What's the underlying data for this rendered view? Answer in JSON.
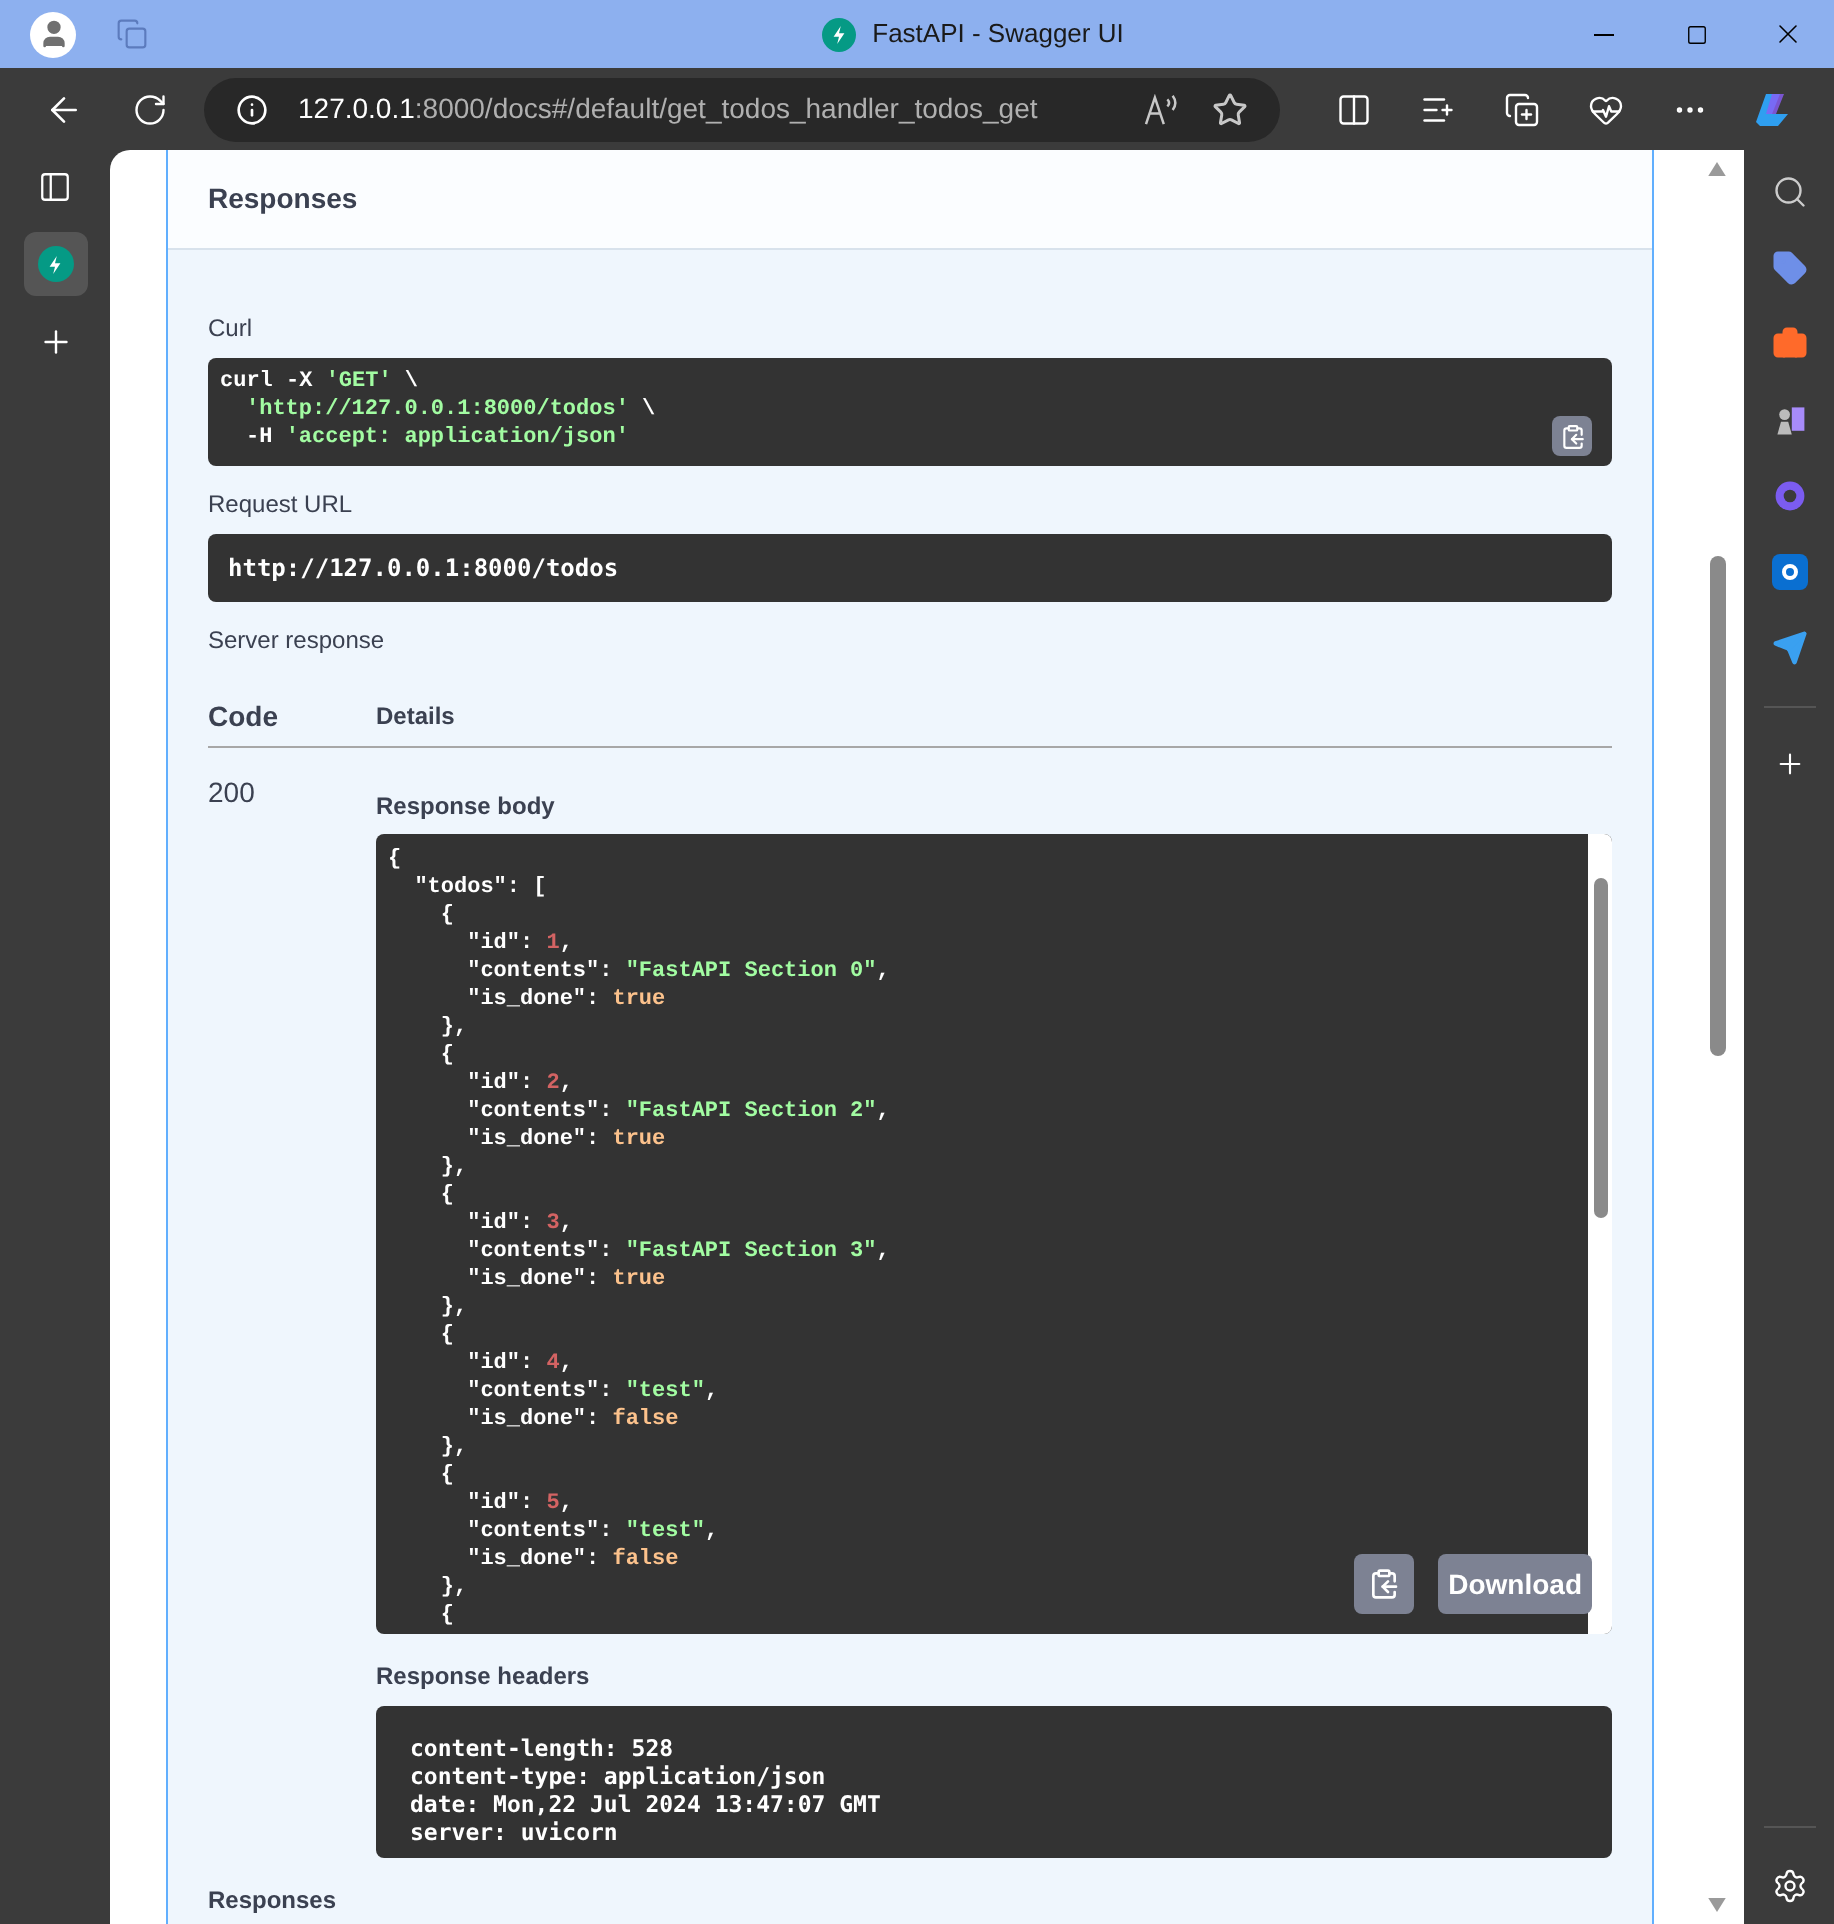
{
  "window": {
    "title": "FastAPI - Swagger UI"
  },
  "address_bar": {
    "host": "127.0.0.1",
    "path": ":8000/docs#/default/get_todos_handler_todos_get"
  },
  "section_header": "Responses",
  "curl": {
    "label": "Curl",
    "lines": [
      [
        {
          "kind": "plain",
          "text": "curl -X "
        },
        {
          "kind": "string",
          "text": "'GET'"
        },
        {
          "kind": "plain",
          "text": " \\"
        }
      ],
      [
        {
          "kind": "string",
          "text": "'http://127.0.0.1:8000/todos'"
        },
        {
          "kind": "plain",
          "text": " \\"
        }
      ],
      [
        {
          "kind": "plain",
          "text": "-H "
        },
        {
          "kind": "string",
          "text": "'accept: application/json'"
        }
      ]
    ]
  },
  "request_url": {
    "label": "Request URL",
    "value": "http://127.0.0.1:8000/todos"
  },
  "server_response": {
    "label": "Server response",
    "columns": [
      "Code",
      "Details"
    ],
    "code": "200",
    "body_label": "Response body",
    "download_label": "Download",
    "headers_label": "Response headers",
    "body_lines": [
      [
        {
          "kind": "plain",
          "text": "{"
        }
      ],
      [
        {
          "kind": "plain",
          "text": "  \"todos\": ["
        }
      ],
      [
        {
          "kind": "plain",
          "text": "    {"
        }
      ],
      [
        {
          "kind": "plain",
          "text": "      \"id\": "
        },
        {
          "kind": "number",
          "text": "1"
        },
        {
          "kind": "plain",
          "text": ","
        }
      ],
      [
        {
          "kind": "plain",
          "text": "      \"contents\": "
        },
        {
          "kind": "string",
          "text": "\"FastAPI Section 0\""
        },
        {
          "kind": "plain",
          "text": ","
        }
      ],
      [
        {
          "kind": "plain",
          "text": "      \"is_done\": "
        },
        {
          "kind": "bool",
          "text": "true"
        }
      ],
      [
        {
          "kind": "plain",
          "text": "    },"
        }
      ],
      [
        {
          "kind": "plain",
          "text": "    {"
        }
      ],
      [
        {
          "kind": "plain",
          "text": "      \"id\": "
        },
        {
          "kind": "number",
          "text": "2"
        },
        {
          "kind": "plain",
          "text": ","
        }
      ],
      [
        {
          "kind": "plain",
          "text": "      \"contents\": "
        },
        {
          "kind": "string",
          "text": "\"FastAPI Section 2\""
        },
        {
          "kind": "plain",
          "text": ","
        }
      ],
      [
        {
          "kind": "plain",
          "text": "      \"is_done\": "
        },
        {
          "kind": "bool",
          "text": "true"
        }
      ],
      [
        {
          "kind": "plain",
          "text": "    },"
        }
      ],
      [
        {
          "kind": "plain",
          "text": "    {"
        }
      ],
      [
        {
          "kind": "plain",
          "text": "      \"id\": "
        },
        {
          "kind": "number",
          "text": "3"
        },
        {
          "kind": "plain",
          "text": ","
        }
      ],
      [
        {
          "kind": "plain",
          "text": "      \"contents\": "
        },
        {
          "kind": "string",
          "text": "\"FastAPI Section 3\""
        },
        {
          "kind": "plain",
          "text": ","
        }
      ],
      [
        {
          "kind": "plain",
          "text": "      \"is_done\": "
        },
        {
          "kind": "bool",
          "text": "true"
        }
      ],
      [
        {
          "kind": "plain",
          "text": "    },"
        }
      ],
      [
        {
          "kind": "plain",
          "text": "    {"
        }
      ],
      [
        {
          "kind": "plain",
          "text": "      \"id\": "
        },
        {
          "kind": "number",
          "text": "4"
        },
        {
          "kind": "plain",
          "text": ","
        }
      ],
      [
        {
          "kind": "plain",
          "text": "      \"contents\": "
        },
        {
          "kind": "string",
          "text": "\"test\""
        },
        {
          "kind": "plain",
          "text": ","
        }
      ],
      [
        {
          "kind": "plain",
          "text": "      \"is_done\": "
        },
        {
          "kind": "bool",
          "text": "false"
        }
      ],
      [
        {
          "kind": "plain",
          "text": "    },"
        }
      ],
      [
        {
          "kind": "plain",
          "text": "    {"
        }
      ],
      [
        {
          "kind": "plain",
          "text": "      \"id\": "
        },
        {
          "kind": "number",
          "text": "5"
        },
        {
          "kind": "plain",
          "text": ","
        }
      ],
      [
        {
          "kind": "plain",
          "text": "      \"contents\": "
        },
        {
          "kind": "string",
          "text": "\"test\""
        },
        {
          "kind": "plain",
          "text": ","
        }
      ],
      [
        {
          "kind": "plain",
          "text": "      \"is_done\": "
        },
        {
          "kind": "bool",
          "text": "false"
        }
      ],
      [
        {
          "kind": "plain",
          "text": "    },"
        }
      ],
      [
        {
          "kind": "plain",
          "text": "    {"
        }
      ]
    ],
    "headers": [
      "content-length: 528",
      "content-type: application/json",
      "date: Mon,22 Jul 2024 13:47:07 GMT",
      "server: uvicorn"
    ]
  },
  "footer_label": "Responses"
}
